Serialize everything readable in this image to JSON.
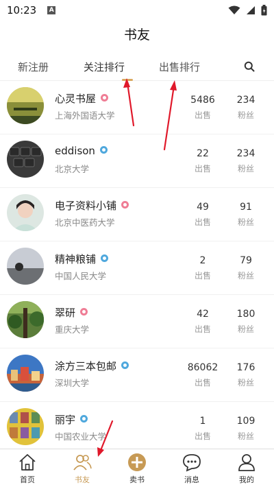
{
  "status": {
    "time": "10:23"
  },
  "header": {
    "title": "书友"
  },
  "tabs": [
    {
      "label": "新注册"
    },
    {
      "label": "关注排行"
    },
    {
      "label": "出售排行"
    }
  ],
  "users": [
    {
      "name": "心灵书屋",
      "school": "上海外国语大学",
      "sold": "5486",
      "fans": "234",
      "gender": "female"
    },
    {
      "name": "eddison",
      "school": "北京大学",
      "sold": "22",
      "fans": "234",
      "gender": "male"
    },
    {
      "name": "电子资料小铺",
      "school": "北京中医药大学",
      "sold": "49",
      "fans": "91",
      "gender": "female"
    },
    {
      "name": "精神粮铺",
      "school": "中国人民大学",
      "sold": "2",
      "fans": "79",
      "gender": "male"
    },
    {
      "name": "翠研",
      "school": "重庆大学",
      "sold": "42",
      "fans": "180",
      "gender": "female"
    },
    {
      "name": "涂方三本包邮",
      "school": "深圳大学",
      "sold": "86062",
      "fans": "176",
      "gender": "male"
    },
    {
      "name": "丽宇",
      "school": "中国农业大学",
      "sold": "1",
      "fans": "109",
      "gender": "male"
    }
  ],
  "labels": {
    "sold": "出售",
    "fans": "粉丝"
  },
  "bottom_nav": [
    {
      "label": "首页"
    },
    {
      "label": "书友"
    },
    {
      "label": "卖书"
    },
    {
      "label": "消息"
    },
    {
      "label": "我的"
    }
  ],
  "colors": {
    "accent": "#c79a55",
    "arrow": "#e0182a",
    "female": "#ef7d95",
    "male": "#4fa8dd"
  }
}
